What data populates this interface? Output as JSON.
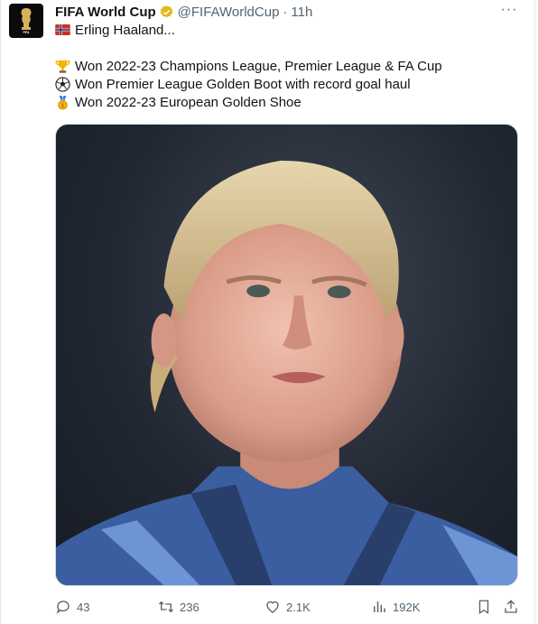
{
  "tweet": {
    "author_name": "FIFA World Cup",
    "handle": "@FIFAWorldCup",
    "separator": "·",
    "time": "11h",
    "more_label": "···",
    "lines": [
      {
        "emoji": "norway-flag-icon",
        "text": "Erling Haaland..."
      },
      {
        "emoji": "trophy-icon",
        "text": "Won 2022-23 Champions League, Premier League & FA Cup"
      },
      {
        "emoji": "soccer-ball-icon",
        "text": "Won Premier League Golden Boot with record goal haul"
      },
      {
        "emoji": "medal-icon",
        "text": "Won 2022-23 European Golden Shoe"
      }
    ],
    "image_alt": "Erling Haaland portrait"
  },
  "actions": {
    "replies": "43",
    "retweets": "236",
    "likes": "2.1K",
    "views": "192K"
  },
  "colors": {
    "text": "#0f1419",
    "muted": "#536471",
    "verified_gold": "#e2b719"
  }
}
